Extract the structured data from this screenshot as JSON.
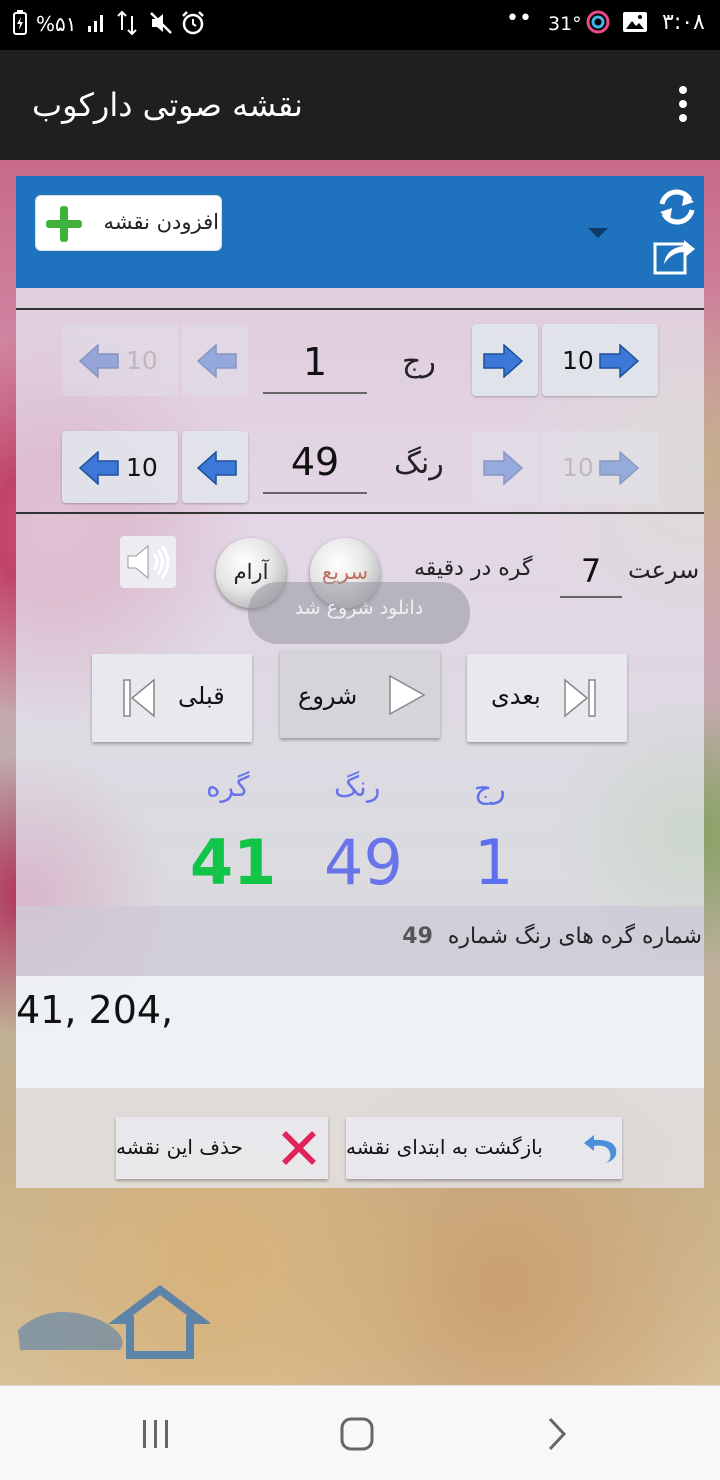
{
  "status_bar": {
    "time": "۳:۰۸",
    "temperature": "31°",
    "dots": "••",
    "battery": "%۵۱"
  },
  "app_bar": {
    "title": "نقشه صوتی دارکوب",
    "menu_icon": "overflow-menu-icon"
  },
  "map_selector": {
    "add_label": "افزودن نقشه",
    "add_icon": "plus-icon",
    "dropdown_icon": "dropdown-arrow-icon",
    "refresh_icon": "refresh-icon",
    "share_icon": "share-icon"
  },
  "row_nav": {
    "label": "رج",
    "value": "1",
    "step10": "10"
  },
  "color_nav": {
    "label": "رنگ",
    "value": "49",
    "step10": "10"
  },
  "speed": {
    "label": "سرعت",
    "value": "7",
    "unit_label": "گره در دقیقه",
    "fast_label": "سریع",
    "slow_label": "آرام",
    "speaker_icon": "speaker-icon"
  },
  "toast": "دانلود شروع شد",
  "playback": {
    "next_label": "بعدی",
    "start_label": "شروع",
    "prev_label": "قبلی"
  },
  "counters": {
    "row_header": "رج",
    "color_header": "رنگ",
    "knot_header": "گره",
    "row_value": "1",
    "color_value": "49",
    "knot_value": "41",
    "colors": {
      "row": "#5c6ff0",
      "color": "#6a74ea",
      "knot": "#12c448"
    }
  },
  "knots_list": {
    "title": "شماره گره های رنگ شماره",
    "color_number": "49",
    "items": "41, 204,"
  },
  "actions": {
    "back_to_start_label": "بازگشت به ابتدای نقشه",
    "delete_label": "حذف این نقشه"
  },
  "nav_bar": {
    "recents_icon": "recents-icon",
    "home_icon": "home-icon",
    "back_icon": "back-icon"
  },
  "theme": {
    "accent": "#1f72be",
    "appbar": "#1f1f1f"
  }
}
